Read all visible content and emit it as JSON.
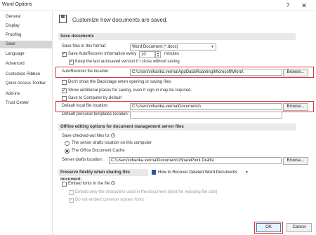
{
  "window": {
    "title": "Word Options",
    "help": "?",
    "close": "✕"
  },
  "sidebar": {
    "items": [
      {
        "label": "General"
      },
      {
        "label": "Display"
      },
      {
        "label": "Proofing"
      },
      {
        "label": "Save",
        "active": true
      },
      {
        "label": "Language"
      },
      {
        "label": "Advanced"
      },
      {
        "label": "Customize Ribbon"
      },
      {
        "label": "Quick Access Toolbar"
      },
      {
        "label": "Add-ins"
      },
      {
        "label": "Trust Center"
      }
    ]
  },
  "header": {
    "text": "Customize how documents are saved."
  },
  "save_documents": {
    "heading": "Save documents",
    "format_label": "Save files in this format:",
    "format_value": "Word Document (*.docx)",
    "autorecover_label": "Save AutoRecover information every",
    "autorecover_minutes": "10",
    "minutes_label": "minutes",
    "keep_last_label": "Keep the last autosaved version if I close without saving",
    "autorecover_location_label": "AutoRecover file location:",
    "autorecover_location_value": "C:\\Users\\niharika.verma\\AppData\\Roaming\\Microsoft\\Word\\",
    "browse1": "Browse...",
    "backstage_label": "Don't show the Backstage when opening or saving files",
    "additional_places_label": "Show additional places for saving, even if sign-in may be required.",
    "save_computer_label": "Save to Computer by default",
    "default_local_label": "Default local file location:",
    "default_local_value": "C:\\Users\\niharika.verma\\Documents\\",
    "browse2": "Browse...",
    "personal_templates_label": "Default personal templates location:",
    "personal_templates_value": ""
  },
  "offline": {
    "heading": "Offline editing options for document management server files",
    "save_checked_out_label": "Save checked-out files to:",
    "info": "i",
    "server_drafts_label": "The server drafts location on this computer",
    "office_cache_label": "The Office Document Cache",
    "server_drafts_location_label": "Server drafts location:",
    "server_drafts_location_value": "C:\\Users\\niharika.verma\\Documents\\SharePoint Drafts\\",
    "browse3": "Browse..."
  },
  "fidelity": {
    "heading": "Preserve fidelity when sharing this document:",
    "document_value": "How to Recover Deleted Word Documents",
    "embed_fonts_label": "Embed fonts in the file",
    "embed_only_label": "Embed only the characters used in the document (best for reducing file size)",
    "no_common_label": "Do not embed common system fonts"
  },
  "footer": {
    "ok": "OK",
    "cancel": "Cancel"
  },
  "colors": {
    "highlight": "#e0363d",
    "active_sidebar": "#d6d6d6",
    "section_bg": "#e9e9e9"
  },
  "icons": {
    "save_header": "floppy-disk-icon",
    "document": "word-document-icon",
    "info": "info-icon"
  }
}
